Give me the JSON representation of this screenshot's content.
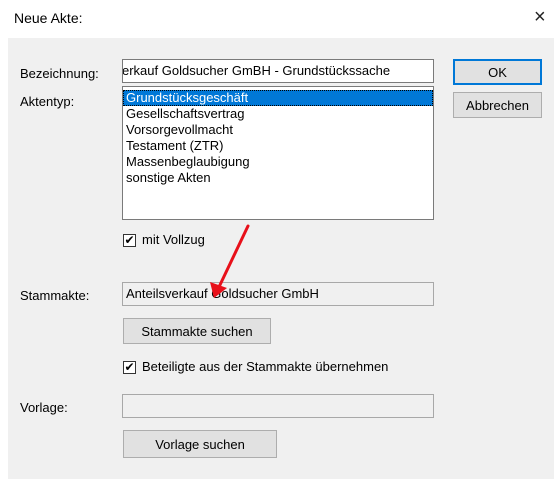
{
  "window": {
    "title": "Neue Akte:",
    "close_glyph": "×"
  },
  "bezeichnung": {
    "label": "Bezeichnung:",
    "value": "erkauf Goldsucher GmBH - Grundstückssache"
  },
  "aktentyp": {
    "label": "Aktentyp:",
    "items": [
      {
        "label": "Grundstücksgeschäft",
        "selected": true
      },
      {
        "label": "Gesellschaftsvertrag",
        "selected": false
      },
      {
        "label": "Vorsorgevollmacht",
        "selected": false
      },
      {
        "label": "Testament (ZTR)",
        "selected": false
      },
      {
        "label": "Massenbeglaubigung",
        "selected": false
      },
      {
        "label": "sonstige Akten",
        "selected": false
      }
    ]
  },
  "vollzug": {
    "label": "mit Vollzug",
    "checked": true
  },
  "stammakte": {
    "label": "Stammakte:",
    "value": "Anteilsverkauf Goldsucher GmbH",
    "search_button": "Stammakte suchen"
  },
  "beteiligte": {
    "label": "Beteiligte aus der Stammakte übernehmen",
    "checked": true
  },
  "vorlage": {
    "label": "Vorlage:",
    "value": "",
    "search_button": "Vorlage suchen"
  },
  "buttons": {
    "ok": "OK",
    "cancel": "Abbrechen"
  },
  "colors": {
    "selection": "#0078d7",
    "annotation_arrow": "#e8101a",
    "dialog_bg": "#f0f0f0"
  },
  "check_glyph": "✔",
  "annotation": {
    "icon": "red-arrow-icon",
    "points_to": "stammakte-search-button"
  }
}
